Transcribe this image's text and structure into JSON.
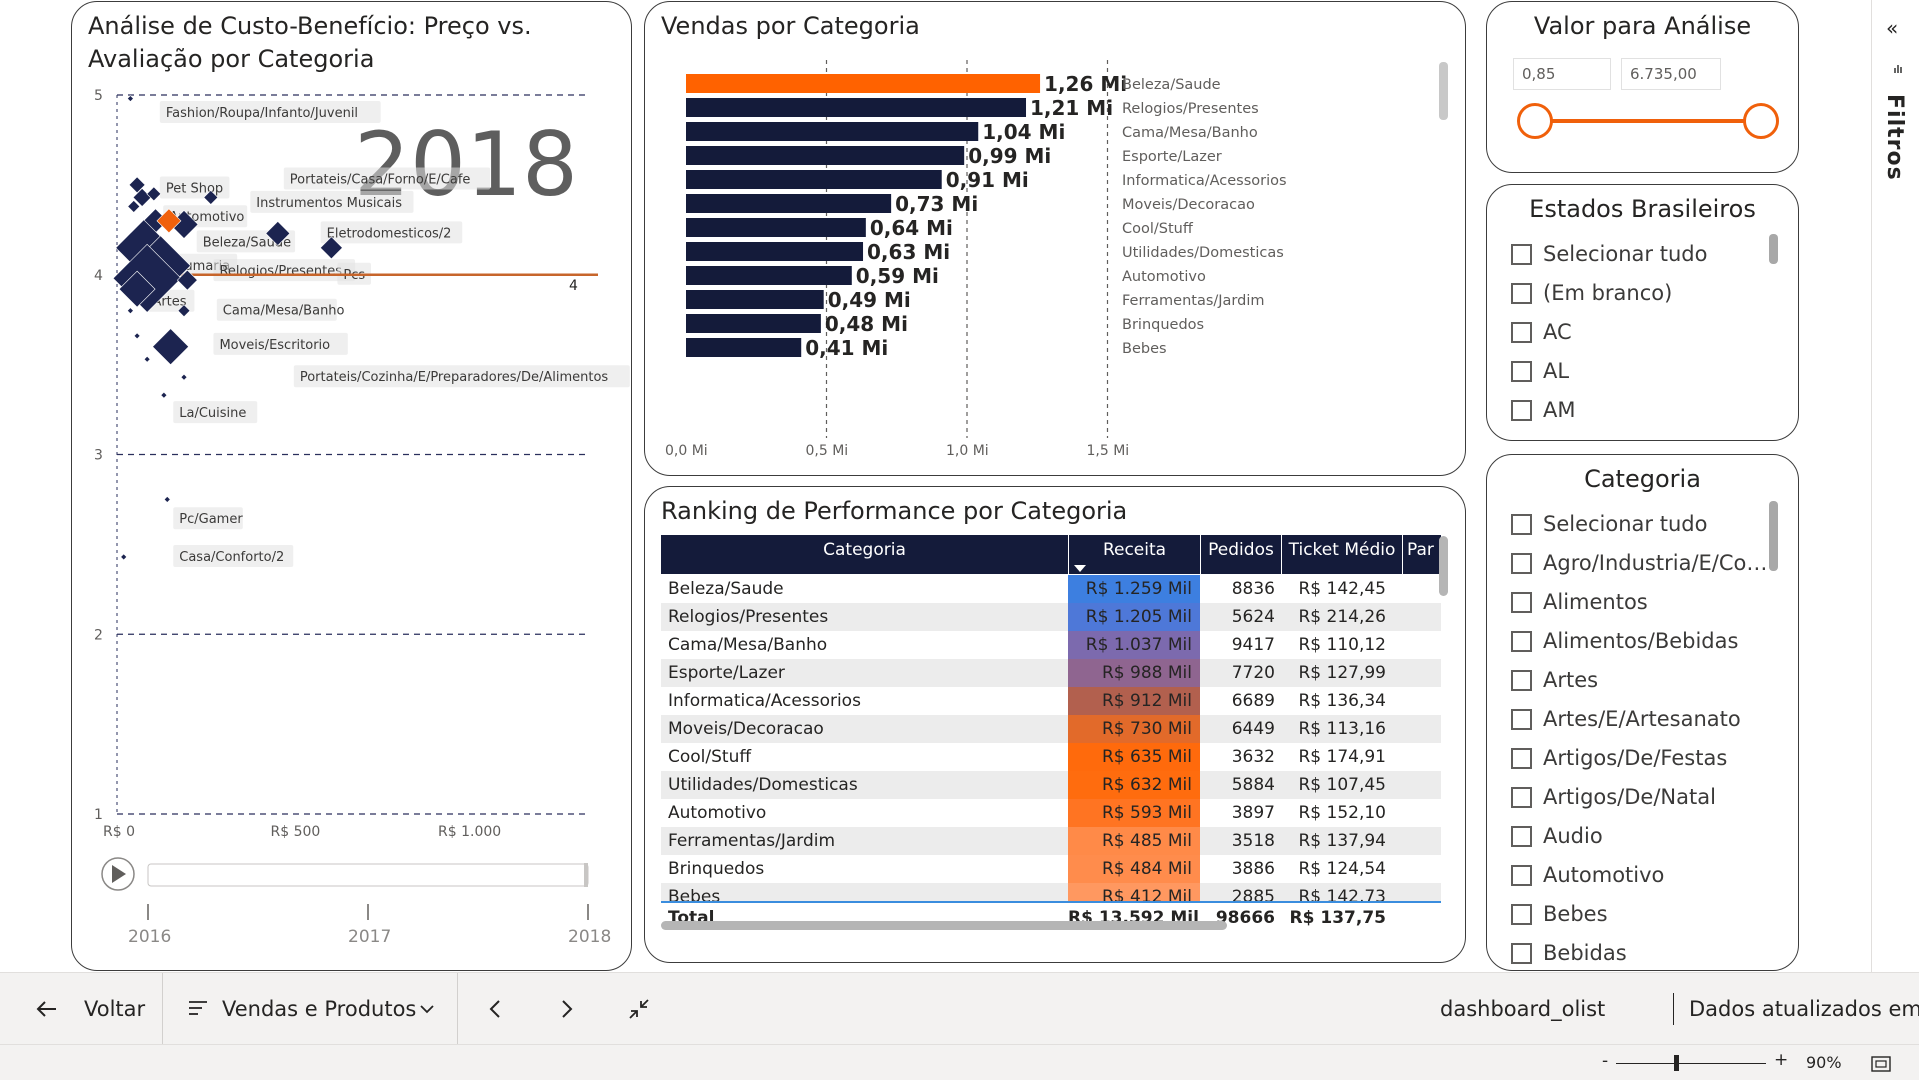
{
  "scatter": {
    "title": "Análise de Custo-Benefício: Preço vs. Avaliação por Categoria",
    "play_axis_value": "2018",
    "y_ticks": [
      "5",
      "4",
      "3",
      "2",
      "1"
    ],
    "x_ticks": [
      "R$ 0",
      "R$ 500",
      "R$ 1.000"
    ],
    "ref_line_label": "4",
    "timeline_labels": [
      "2016",
      "2017",
      "2018"
    ],
    "labels": [
      {
        "text": "Fashion/Roupa/Infanto/Juvenil",
        "price": 110,
        "rating": 4.9
      },
      {
        "text": "Portateis/Casa/Forno/E/Cafe",
        "price": 480,
        "rating": 4.53
      },
      {
        "text": "Pet Shop",
        "price": 110,
        "rating": 4.48
      },
      {
        "text": "Instrumentos Musicais",
        "price": 380,
        "rating": 4.4
      },
      {
        "text": "Automotivo",
        "price": 120,
        "rating": 4.32
      },
      {
        "text": "Eletrodomesticos/2",
        "price": 590,
        "rating": 4.23
      },
      {
        "text": "Beleza/Saude",
        "price": 220,
        "rating": 4.18
      },
      {
        "text": "Perfumaria",
        "price": 90,
        "rating": 4.05
      },
      {
        "text": "Relogios/Presentes",
        "price": 270,
        "rating": 4.02
      },
      {
        "text": "Pcs",
        "price": 640,
        "rating": 4.0
      },
      {
        "text": "Artes",
        "price": 70,
        "rating": 3.85
      },
      {
        "text": "Cama/Mesa/Banho",
        "price": 280,
        "rating": 3.8
      },
      {
        "text": "Moveis/Escritorio",
        "price": 270,
        "rating": 3.61
      },
      {
        "text": "Portateis/Cozinha/E/Preparadores/De/Alimentos",
        "price": 510,
        "rating": 3.43
      },
      {
        "text": "La/Cuisine",
        "price": 150,
        "rating": 3.23
      },
      {
        "text": "Pc/Gamer",
        "price": 150,
        "rating": 2.64
      },
      {
        "text": "Casa/Conforto/2",
        "price": 150,
        "rating": 2.43
      }
    ],
    "points": [
      {
        "price": 40,
        "rating": 4.98,
        "size": 3
      },
      {
        "price": 60,
        "rating": 4.5,
        "size": 8
      },
      {
        "price": 75,
        "rating": 4.43,
        "size": 9
      },
      {
        "price": 50,
        "rating": 4.38,
        "size": 6
      },
      {
        "price": 110,
        "rating": 4.45,
        "size": 7
      },
      {
        "price": 115,
        "rating": 4.3,
        "size": 12
      },
      {
        "price": 200,
        "rating": 4.28,
        "size": 14
      },
      {
        "price": 80,
        "rating": 4.15,
        "size": 28
      },
      {
        "price": 130,
        "rating": 4.05,
        "size": 30
      },
      {
        "price": 90,
        "rating": 3.98,
        "size": 34
      },
      {
        "price": 60,
        "rating": 3.92,
        "size": 18
      },
      {
        "price": 40,
        "rating": 3.8,
        "size": 3
      },
      {
        "price": 210,
        "rating": 3.97,
        "size": 10
      },
      {
        "price": 280,
        "rating": 4.43,
        "size": 7
      },
      {
        "price": 480,
        "rating": 4.23,
        "size": 12
      },
      {
        "price": 640,
        "rating": 4.15,
        "size": 11
      },
      {
        "price": 200,
        "rating": 3.8,
        "size": 6
      },
      {
        "price": 60,
        "rating": 3.66,
        "size": 3
      },
      {
        "price": 160,
        "rating": 3.6,
        "size": 18
      },
      {
        "price": 90,
        "rating": 3.53,
        "size": 3
      },
      {
        "price": 200,
        "rating": 3.43,
        "size": 3
      },
      {
        "price": 140,
        "rating": 3.33,
        "size": 3
      },
      {
        "price": 150,
        "rating": 2.75,
        "size": 3
      },
      {
        "price": 20,
        "rating": 2.43,
        "size": 3
      }
    ],
    "highlight_point": {
      "price": 155,
      "rating": 4.3,
      "size": 12
    },
    "reference_rating": 4.0,
    "x_max": 1400,
    "y_min": 1,
    "y_max": 5
  },
  "chart_data": {
    "type": "bar",
    "title": "Vendas por Categoria",
    "categories": [
      "Beleza/Saude",
      "Relogios/Presentes",
      "Cama/Mesa/Banho",
      "Esporte/Lazer",
      "Informatica/Acessorios",
      "Moveis/Decoracao",
      "Cool/Stuff",
      "Utilidades/Domesticas",
      "Automotivo",
      "Ferramentas/Jardim",
      "Brinquedos",
      "Bebes"
    ],
    "values": [
      1.26,
      1.21,
      1.04,
      0.99,
      0.91,
      0.73,
      0.64,
      0.63,
      0.59,
      0.49,
      0.48,
      0.41
    ],
    "value_labels": [
      "1,26 Mi",
      "1,21 Mi",
      "1,04 Mi",
      "0,99 Mi",
      "0,91 Mi",
      "0,73 Mi",
      "0,64 Mi",
      "0,63 Mi",
      "0,59 Mi",
      "0,49 Mi",
      "0,48 Mi",
      "0,41 Mi"
    ],
    "x_ticks": [
      "0,0 Mi",
      "0,5 Mi",
      "1,0 Mi",
      "1,5 Mi"
    ],
    "xlim": [
      0,
      1.5
    ],
    "highlight_index": 0,
    "bar_color": "#141b3a",
    "highlight_color": "#ff6200"
  },
  "table": {
    "title": "Ranking de Performance por Categoria",
    "headers": [
      "Categoria",
      "Receita",
      "Pedidos",
      "Ticket Médio",
      "Par"
    ],
    "rows": [
      {
        "categoria": "Beleza/Saude",
        "receita": "R$ 1.259 Mil",
        "pedidos": "8836",
        "ticket": "R$ 142,45",
        "bg": "#3d7fe0"
      },
      {
        "categoria": "Relogios/Presentes",
        "receita": "R$ 1.205 Mil",
        "pedidos": "5624",
        "ticket": "R$ 214,26",
        "bg": "#4e78d8"
      },
      {
        "categoria": "Cama/Mesa/Banho",
        "receita": "R$ 1.037 Mil",
        "pedidos": "9417",
        "ticket": "R$ 110,12",
        "bg": "#7c6aae"
      },
      {
        "categoria": "Esporte/Lazer",
        "receita": "R$ 988 Mil",
        "pedidos": "7720",
        "ticket": "R$ 127,99",
        "bg": "#8f6590"
      },
      {
        "categoria": "Informatica/Acessorios",
        "receita": "R$ 912 Mil",
        "pedidos": "6689",
        "ticket": "R$ 136,34",
        "bg": "#b2604e"
      },
      {
        "categoria": "Moveis/Decoracao",
        "receita": "R$ 730 Mil",
        "pedidos": "6449",
        "ticket": "R$ 113,16",
        "bg": "#e26a2a"
      },
      {
        "categoria": "Cool/Stuff",
        "receita": "R$ 635 Mil",
        "pedidos": "3632",
        "ticket": "R$ 174,91",
        "bg": "#ff6a0c"
      },
      {
        "categoria": "Utilidades/Domesticas",
        "receita": "R$ 632 Mil",
        "pedidos": "5884",
        "ticket": "R$ 107,45",
        "bg": "#ff6c0e"
      },
      {
        "categoria": "Automotivo",
        "receita": "R$ 593 Mil",
        "pedidos": "3897",
        "ticket": "R$ 152,10",
        "bg": "#ff7422"
      },
      {
        "categoria": "Ferramentas/Jardim",
        "receita": "R$ 485 Mil",
        "pedidos": "3518",
        "ticket": "R$ 137,94",
        "bg": "#ff8a48"
      },
      {
        "categoria": "Brinquedos",
        "receita": "R$ 484 Mil",
        "pedidos": "3886",
        "ticket": "R$ 124,54",
        "bg": "#ff8c4c"
      },
      {
        "categoria": "Bebes",
        "receita": "R$ 412 Mil",
        "pedidos": "2885",
        "ticket": "R$ 142,73",
        "bg": "#ff9860"
      }
    ],
    "total": {
      "label": "Total",
      "receita": "R$ 13.592 Mil",
      "pedidos": "98666",
      "ticket": "R$ 137,75"
    }
  },
  "valor": {
    "title": "Valor para Análise",
    "min_value": "0,85",
    "max_value": "6.735,00",
    "accent_color": "#f0600b"
  },
  "estados": {
    "title": "Estados Brasileiros",
    "items": [
      "Selecionar tudo",
      "(Em branco)",
      "AC",
      "AL",
      "AM"
    ]
  },
  "categoria_slicer": {
    "title": "Categoria",
    "items": [
      "Selecionar tudo",
      "Agro/Industria/E/Comercio",
      "Alimentos",
      "Alimentos/Bebidas",
      "Artes",
      "Artes/E/Artesanato",
      "Artigos/De/Festas",
      "Artigos/De/Natal",
      "Audio",
      "Automotivo",
      "Bebes",
      "Bebidas"
    ]
  },
  "filtros": {
    "label": "Filtros",
    "collapse_glyph": "«"
  },
  "nav": {
    "back_label": "Voltar",
    "page_label": "Vendas e Produtos",
    "report_name": "dashboard_olist",
    "updated_label": "Dados atualizados em..."
  },
  "zoom": {
    "minus": "-",
    "plus": "+",
    "level": "90%",
    "level_value": 90
  }
}
